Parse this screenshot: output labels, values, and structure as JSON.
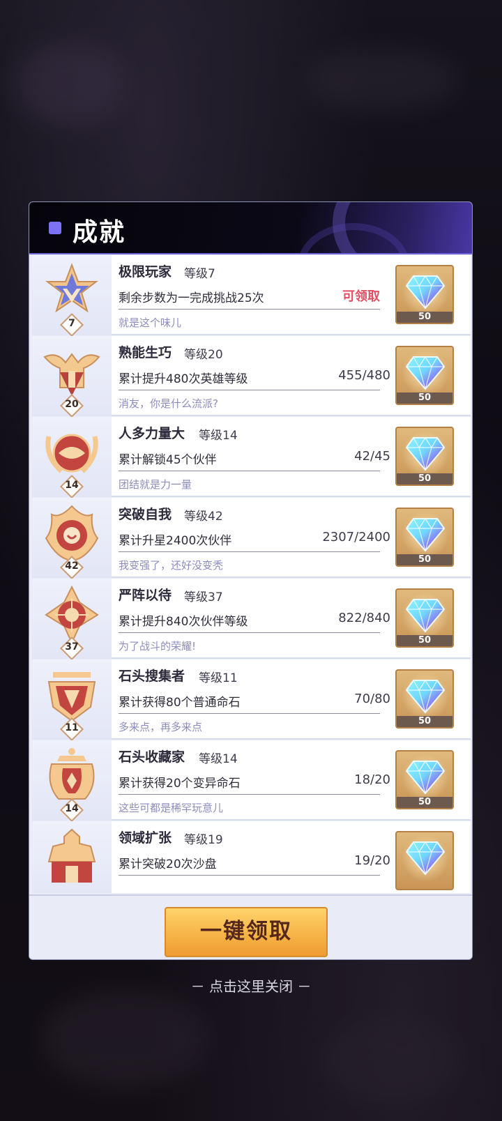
{
  "header": {
    "title": "成就"
  },
  "achievements": [
    {
      "name": "极限玩家",
      "level": "等级7",
      "desc": "剩余步数为一完成挑战25次",
      "status": "可领取",
      "progress": "",
      "motto": "就是这个味儿",
      "badge": "7",
      "reward": "50",
      "emblem": "star-crest-icon",
      "colors": [
        "#6f79d9",
        "#f2c48c"
      ]
    },
    {
      "name": "熟能生巧",
      "level": "等级20",
      "desc": "累计提升480次英雄等级",
      "status": "",
      "progress": "455/480",
      "motto": "消友，你是什么流派?",
      "badge": "20",
      "reward": "50",
      "emblem": "winged-tower-icon",
      "colors": [
        "#b8433e",
        "#f3c98f"
      ]
    },
    {
      "name": "人多力量大",
      "level": "等级14",
      "desc": "累计解锁45个伙伴",
      "status": "",
      "progress": "42/45",
      "motto": "团结就是力一量",
      "badge": "14",
      "reward": "50",
      "emblem": "handshake-laurel-icon",
      "colors": [
        "#c2463f",
        "#f4c88e"
      ]
    },
    {
      "name": "突破自我",
      "level": "等级42",
      "desc": "累计升星2400次伙伴",
      "status": "",
      "progress": "2307/2400",
      "motto": "我变强了，还好没变秃",
      "badge": "42",
      "reward": "50",
      "emblem": "flame-eye-icon",
      "colors": [
        "#c2463f",
        "#f4c88e"
      ]
    },
    {
      "name": "严阵以待",
      "level": "等级37",
      "desc": "累计提升840次伙伴等级",
      "status": "",
      "progress": "822/840",
      "motto": "为了战斗的荣耀!",
      "badge": "37",
      "reward": "50",
      "emblem": "crosshair-shield-icon",
      "colors": [
        "#c2463f",
        "#f4c88e"
      ]
    },
    {
      "name": "石头搜集者",
      "level": "等级11",
      "desc": "累计获得80个普通命石",
      "status": "",
      "progress": "70/80",
      "motto": "多来点，再多来点",
      "badge": "11",
      "reward": "50",
      "emblem": "stone-crest-icon",
      "colors": [
        "#c2463f",
        "#f4c88e"
      ]
    },
    {
      "name": "石头收藏家",
      "level": "等级14",
      "desc": "累计获得20个变异命石",
      "status": "",
      "progress": "18/20",
      "motto": "这些可都是稀罕玩意儿",
      "badge": "14",
      "reward": "50",
      "emblem": "jar-crest-icon",
      "colors": [
        "#c2463f",
        "#f4c88e"
      ]
    },
    {
      "name": "领域扩张",
      "level": "等级19",
      "desc": "累计突破20次沙盘",
      "status": "",
      "progress": "19/20",
      "motto": "",
      "badge": "",
      "reward": "",
      "emblem": "castle-crest-icon",
      "colors": [
        "#c2463f",
        "#f4c88e"
      ]
    }
  ],
  "footer": {
    "claim_all_label": "一键领取"
  },
  "close_hint": "－ 点击这里关闭 －"
}
